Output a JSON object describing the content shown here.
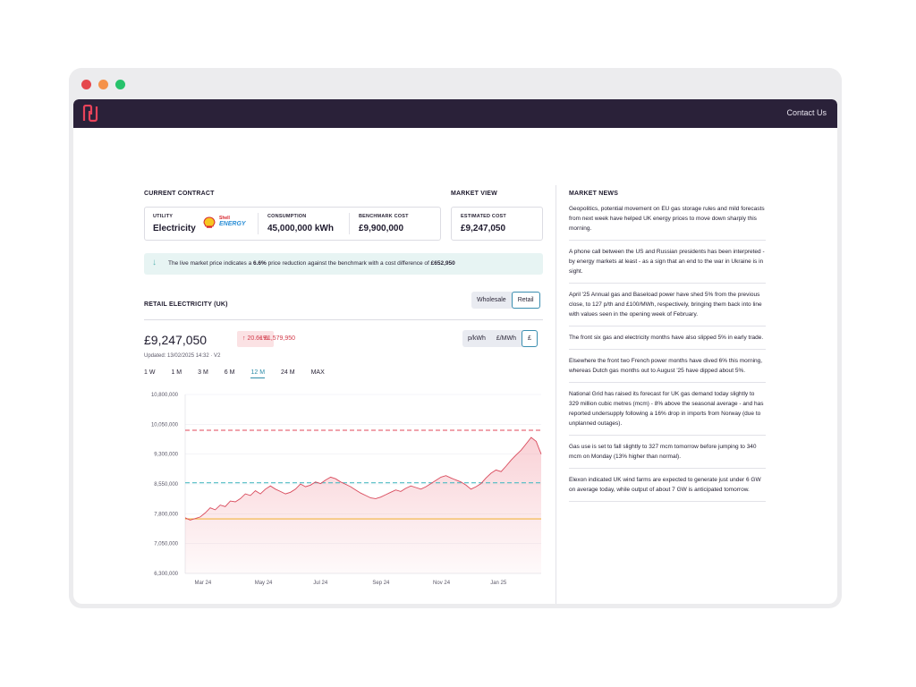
{
  "window": {
    "nav": {
      "contact_label": "Contact Us"
    }
  },
  "contract": {
    "heading": "CURRENT CONTRACT",
    "utility_caption": "UTILITY",
    "utility_value": "Electricity",
    "supplier_logo_line1": "Shell",
    "supplier_logo_line2": "ENERGY",
    "consumption_caption": "CONSUMPTION",
    "consumption_value": "45,000,000 kWh",
    "benchmark_caption": "BENCHMARK COST",
    "benchmark_value": "£9,900,000"
  },
  "market_view": {
    "heading": "MARKET VIEW",
    "estimated_caption": "ESTIMATED COST",
    "estimated_value": "£9,247,050"
  },
  "banner": {
    "text_before": "The live market price indicates a ",
    "pct": "6.6%",
    "text_middle": " price reduction against the benchmark with a cost difference of ",
    "amount": "£652,950"
  },
  "retail": {
    "heading": "RETAIL ELECTRICITY (UK)",
    "view_options": [
      "Wholesale",
      "Retail"
    ],
    "view_selected": "Retail",
    "price": "£9,247,050",
    "pct_change": "20.61%",
    "abs_change": "+ £1,579,950",
    "updated": "Updated: 13/02/2025 14:32 · V2",
    "unit_options": [
      "p/kWh",
      "£/MWh",
      "£"
    ],
    "unit_selected": "£",
    "ranges": [
      "1 W",
      "1 M",
      "3 M",
      "6 M",
      "12 M",
      "24 M",
      "MAX"
    ],
    "range_selected": "12 M"
  },
  "chart_data": {
    "type": "area",
    "ylim": [
      6300000,
      10800000
    ],
    "y_ticks": [
      "10,800,000",
      "10,050,000",
      "9,300,000",
      "8,550,000",
      "7,800,000",
      "7,050,000",
      "6,300,000"
    ],
    "y_tick_values": [
      10800000,
      10050000,
      9300000,
      8550000,
      7800000,
      7050000,
      6300000
    ],
    "x_ticks": [
      "Mar 24",
      "May 24",
      "Jul 24",
      "Sep 24",
      "Nov 24",
      "Jan 25"
    ],
    "x_tick_positions": [
      0.05,
      0.22,
      0.38,
      0.55,
      0.72,
      0.88
    ],
    "reference_lines": [
      {
        "value": 9900000,
        "color": "#e0475a",
        "style": "dashed"
      },
      {
        "value": 8580000,
        "color": "#4fbcc4",
        "style": "dashed"
      },
      {
        "value": 7670000,
        "color": "#f2b441",
        "style": "solid"
      }
    ],
    "series": [
      {
        "color": "#d94a5c",
        "values": [
          7700000,
          7640000,
          7680000,
          7720000,
          7820000,
          7950000,
          7900000,
          8020000,
          7980000,
          8120000,
          8100000,
          8180000,
          8300000,
          8260000,
          8380000,
          8300000,
          8420000,
          8500000,
          8420000,
          8360000,
          8300000,
          8340000,
          8420000,
          8550000,
          8480000,
          8520000,
          8600000,
          8560000,
          8650000,
          8720000,
          8680000,
          8600000,
          8540000,
          8480000,
          8400000,
          8320000,
          8260000,
          8200000,
          8180000,
          8220000,
          8280000,
          8340000,
          8400000,
          8360000,
          8440000,
          8500000,
          8460000,
          8420000,
          8480000,
          8560000,
          8640000,
          8720000,
          8760000,
          8700000,
          8650000,
          8600000,
          8520000,
          8420000,
          8480000,
          8560000,
          8700000,
          8820000,
          8900000,
          8860000,
          9000000,
          9150000,
          9280000,
          9400000,
          9560000,
          9720000,
          9620000,
          9300000
        ]
      }
    ]
  },
  "news": {
    "heading": "MARKET NEWS",
    "items": [
      "Geopolitics, potential movement on EU gas storage rules and mild forecasts from next week have helped UK energy prices to move down sharply this morning.",
      "A phone call between the US and Russian presidents has been interpreted - by energy markets at least - as a sign that an end to the war in Ukraine is in sight.",
      "April '25 Annual gas and Baseload power have shed 5% from the previous close, to 127 p/th and £100/MWh, respectively, bringing them back into line with values seen in the opening week of February.",
      "The front six gas and electricity months have also slipped 5% in early trade.",
      "Elsewhere the front two French power months have dived 6% this morning, whereas Dutch gas months out to August '25 have dipped about 5%.",
      "National Grid has raised its forecast for UK gas demand today slightly to 329 million cubic metres (mcm) - 8% above the seasonal average - and has reported undersupply following a 16% drop in imports from Norway (due to unplanned outages).",
      "Gas use is set to fall slightly to 327 mcm tomorrow before jumping to 340 mcm on Monday (13% higher than normal).",
      "Elexon indicated UK wind farms are expected to generate just under 6 GW on average today, while output of about 7 GW is anticipated tomorrow."
    ]
  }
}
